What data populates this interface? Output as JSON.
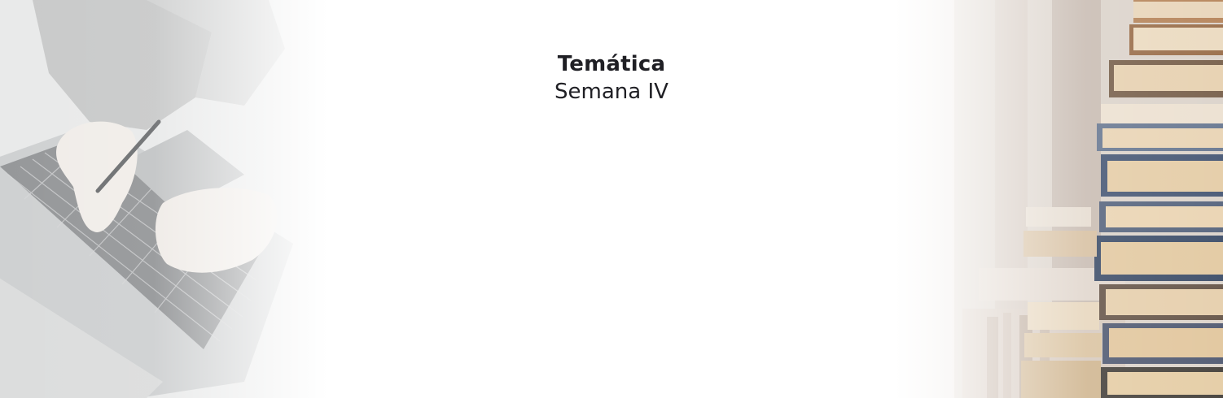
{
  "heading": {
    "title": "Temática",
    "subtitle": "Semana IV"
  },
  "images": {
    "left": "laptop-typing-photo",
    "right": "stacked-books-photo"
  },
  "colors": {
    "background": "#ffffff",
    "text": "#1f1f24"
  }
}
